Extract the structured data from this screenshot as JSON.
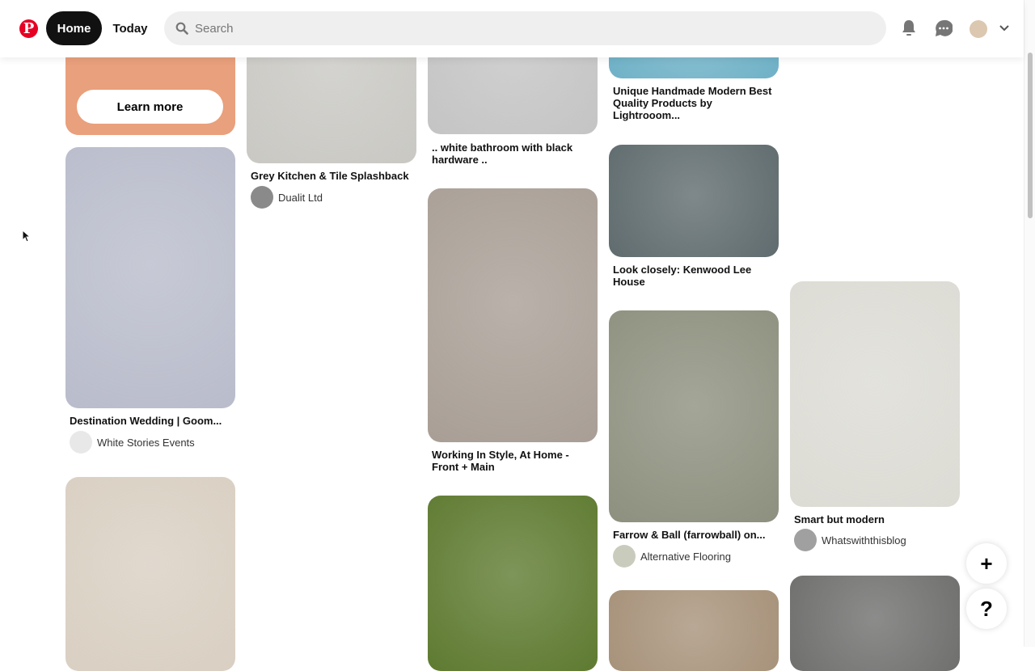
{
  "header": {
    "home_label": "Home",
    "today_label": "Today",
    "search_placeholder": "Search",
    "brand_color": "#e60023"
  },
  "promo": {
    "button_label": "Learn more"
  },
  "columns": [
    [
      {
        "color": "#b9bccb",
        "title": "Destination Wedding | Goom...",
        "creator": "White Stories Events",
        "creator_color": "#e8e8e8"
      },
      {
        "color": "#d9cfc2"
      }
    ],
    [
      {
        "color": "#c9c8c3",
        "title": "Grey Kitchen & Tile Splashback",
        "creator": "Dualit Ltd",
        "creator_color": "#8a8a8a"
      }
    ],
    [
      {
        "color": "#c4c4c4",
        "title": ".. white bathroom with black hardware .."
      },
      {
        "color": "#a89e95",
        "title": "Working In Style, At Home - Front + Main"
      },
      {
        "color": "#5e7a30"
      }
    ],
    [
      {
        "color": "#6fb1c7",
        "title": "Unique Handmade Modern Best Quality Products by Lightrooom..."
      },
      {
        "color": "#5f6b6e",
        "title": "Look closely: Kenwood Lee House"
      },
      {
        "color": "#8d907e",
        "title": "Farrow & Ball (farrowball) on...",
        "creator": "Alternative Flooring",
        "creator_color": "#c9ccbd"
      },
      {
        "color": "#a7927a"
      }
    ],
    [
      {
        "color": "#dcdbd4",
        "title": "Smart but modern",
        "creator": "Whatswiththisblog",
        "creator_color": "#a0a0a0"
      },
      {
        "color": "#6f6f6e"
      }
    ]
  ],
  "fab": {
    "add_label": "+",
    "help_label": "?"
  }
}
